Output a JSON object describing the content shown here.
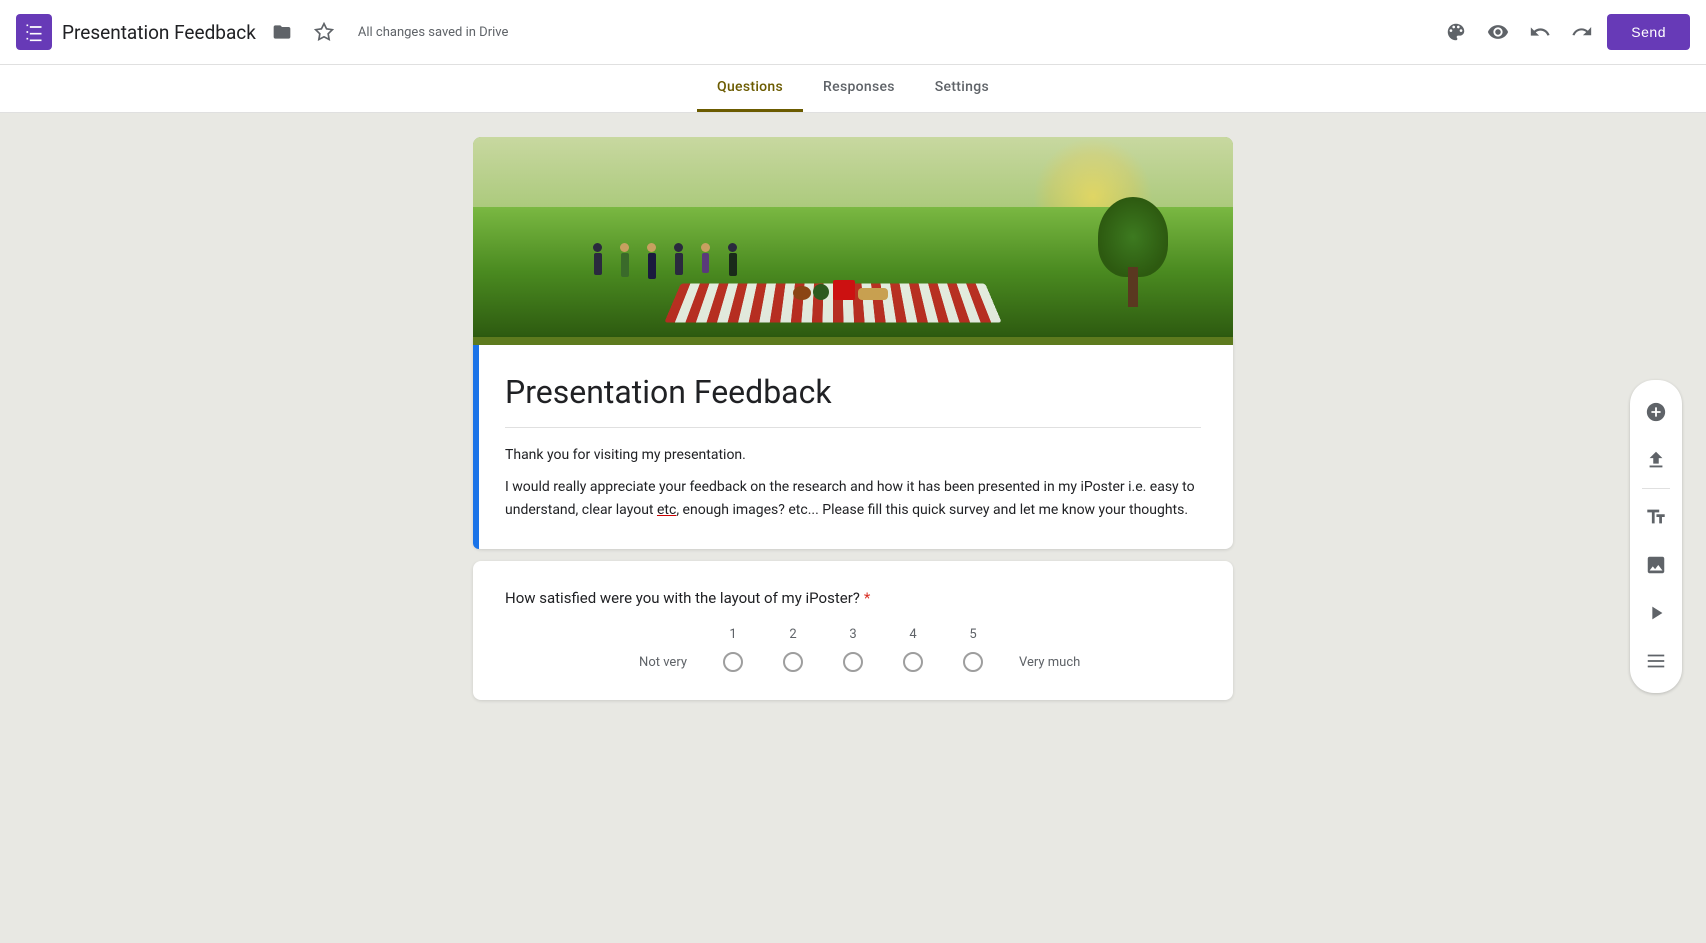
{
  "header": {
    "title": "Presentation Feedback",
    "saved_text": "All changes saved in Drive",
    "send_label": "Send"
  },
  "tabs": {
    "items": [
      {
        "label": "Questions",
        "active": true
      },
      {
        "label": "Responses",
        "active": false
      },
      {
        "label": "Settings",
        "active": false
      }
    ]
  },
  "form": {
    "title": "Presentation Feedback",
    "description1": "Thank you for visiting my presentation.",
    "description2_prefix": "I would really appreciate your feedback on the research and how it has been presented in my iPoster i.e.  easy to understand, clear layout ",
    "description2_underline": "etc",
    "description2_suffix": ", enough images? etc... Please fill this quick survey and let me know your thoughts.",
    "question1": {
      "text": "How satisfied were you with the layout of my iPoster?",
      "required": true,
      "scale": {
        "numbers": [
          "1",
          "2",
          "3",
          "4",
          "5"
        ],
        "label_left": "Not very",
        "label_right": "Very much"
      }
    }
  },
  "sidebar": {
    "icons": [
      {
        "name": "add-circle-icon",
        "symbol": "+"
      },
      {
        "name": "import-icon",
        "symbol": "⤵"
      },
      {
        "name": "text-icon",
        "symbol": "Tt"
      },
      {
        "name": "image-icon",
        "symbol": "🖼"
      },
      {
        "name": "video-icon",
        "symbol": "▶"
      },
      {
        "name": "section-icon",
        "symbol": "☰"
      }
    ]
  }
}
